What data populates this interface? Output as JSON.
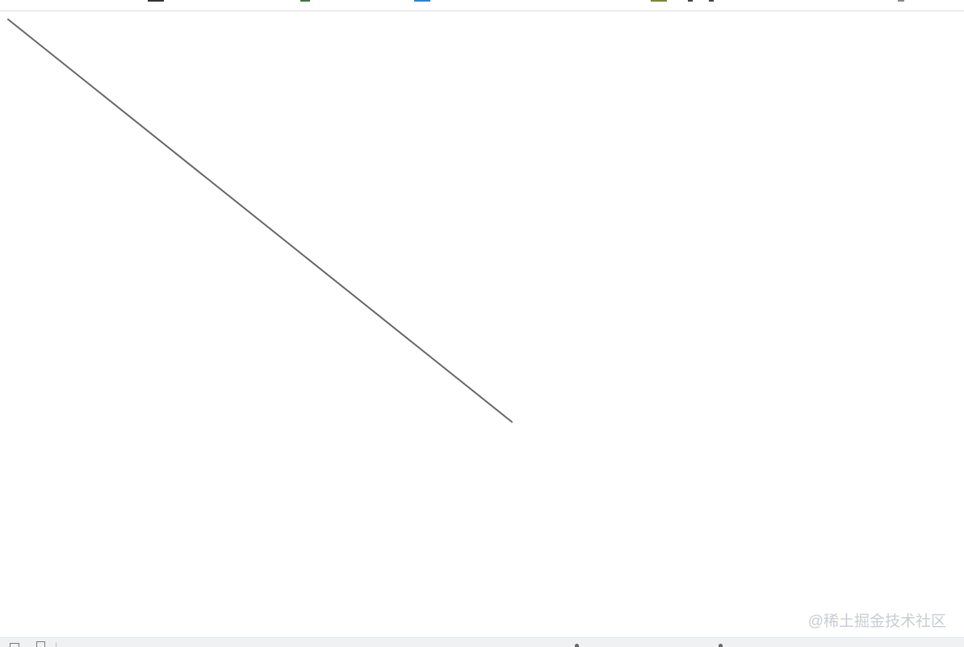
{
  "watermark": {
    "text": "@稀土掘金技术社区"
  },
  "canvas": {
    "line": {
      "color": "#666666"
    }
  },
  "top_bar": {
    "icons": [
      {
        "name": "toolbar-icon-dark",
        "color": "#333333"
      },
      {
        "name": "toolbar-icon-green",
        "color": "#3a7a3a"
      },
      {
        "name": "toolbar-icon-blue",
        "color": "#1e88e5"
      },
      {
        "name": "toolbar-icon-olive",
        "color": "#7a8a2a"
      },
      {
        "name": "toolbar-icon-misc",
        "color": "#444444"
      }
    ]
  },
  "colors": {
    "background": "#ffffff",
    "watermark": "#c9ccd1",
    "bottom_bar": "#f0f1f3"
  }
}
